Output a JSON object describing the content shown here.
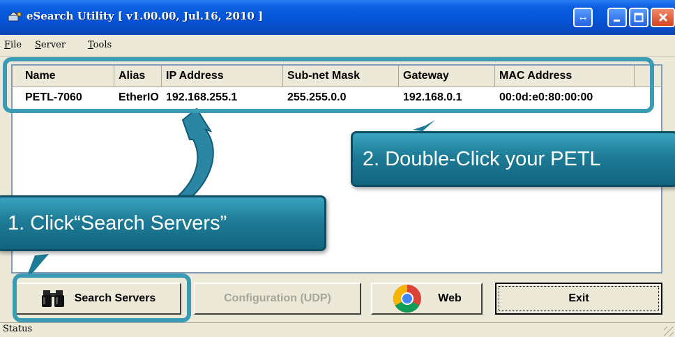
{
  "window": {
    "title": "eSearch Utility [ v1.00.00, Jul.16, 2010 ]",
    "icon": "esearch-app-icon",
    "controls": [
      "swap-icon",
      "minimize-icon",
      "maximize-icon",
      "close-icon"
    ]
  },
  "menu": {
    "items": [
      "File",
      "Server",
      "Tools"
    ]
  },
  "list": {
    "columns": [
      "Name",
      "Alias",
      "IP Address",
      "Sub-net Mask",
      "Gateway",
      "MAC Address"
    ],
    "rows": [
      [
        "PETL-7060",
        "EtherIO",
        "192.168.255.1",
        "255.255.0.0",
        "192.168.0.1",
        "00:0d:e0:80:00:00"
      ]
    ]
  },
  "buttons": {
    "search": {
      "label": "Search Servers",
      "icon": "binoculars-icon"
    },
    "config": {
      "label": "Configuration (UDP)",
      "enabled": false
    },
    "web": {
      "label": "Web",
      "icon": "chrome-icon"
    },
    "exit": {
      "label": "Exit"
    }
  },
  "status": {
    "text": "Status"
  },
  "annotations": {
    "step1": "1. Click“Search Servers”",
    "step2": "2. Double-Click your PETL"
  },
  "colors": {
    "title_bar": "#0553d6",
    "window_bg": "#ece9d8",
    "callout": "#1e7b96",
    "highlight": "#3a9bb5"
  }
}
